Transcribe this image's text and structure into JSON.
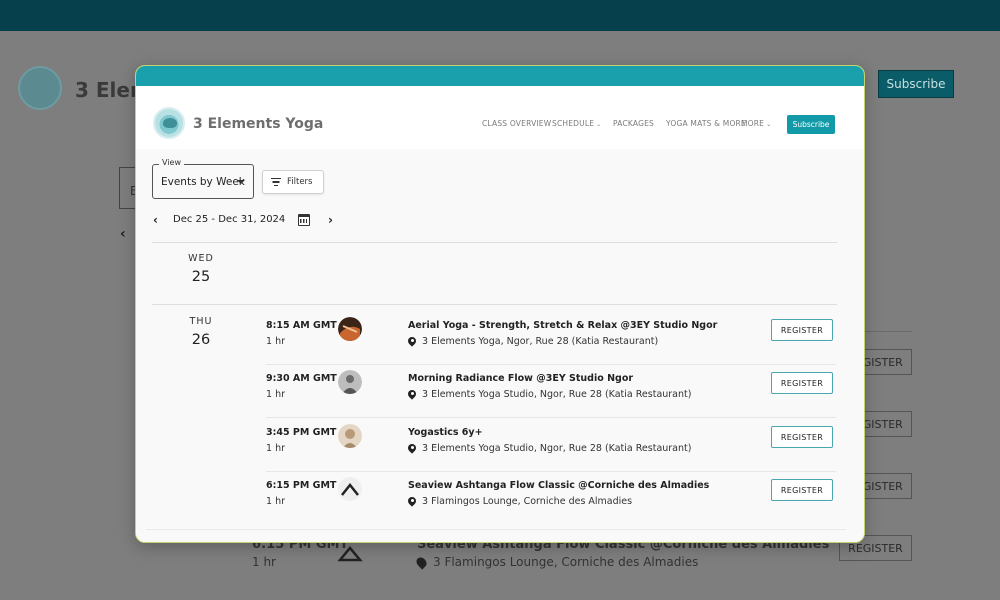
{
  "background": {
    "brand": "3 Elem",
    "subscribe_label": "Subscribe",
    "view_letter": "E",
    "register_label": "REGISTER",
    "last_event": {
      "time": "6:15 PM GMT",
      "duration": "1 hr",
      "title": "Seaview Ashtanga Flow Classic @Corniche des Almadies",
      "location": "3 Flamingos Lounge, Corniche des Almadies"
    }
  },
  "header": {
    "brand": "3 Elements Yoga",
    "nav": [
      {
        "label": "CLASS OVERVIEW",
        "dropdown": false
      },
      {
        "label": "SCHEDULE",
        "dropdown": true
      },
      {
        "label": "PACKAGES",
        "dropdown": false
      },
      {
        "label": "YOGA MATS & MORE",
        "dropdown": false
      },
      {
        "label": "MORE",
        "dropdown": true
      }
    ],
    "subscribe_label": "Subscribe"
  },
  "toolbar": {
    "view_label": "View",
    "view_value": "Events by Week",
    "filters_label": "Filters",
    "date_range": "Dec 25 - Dec 31, 2024"
  },
  "days": [
    {
      "name": "WED",
      "num": "25"
    },
    {
      "name": "THU",
      "num": "26"
    }
  ],
  "events": [
    {
      "time": "8:15 AM GMT",
      "duration": "1 hr",
      "title": "Aerial Yoga - Strength, Stretch & Relax @3EY Studio Ngor",
      "location": "3 Elements Yoga, Ngor, Rue 28 (Katia Restaurant)",
      "register": "REGISTER",
      "avatar_color": "#8a4a2a"
    },
    {
      "time": "9:30 AM GMT",
      "duration": "1 hr",
      "title": "Morning Radiance Flow @3EY Studio Ngor",
      "location": "3 Elements Yoga Studio, Ngor, Rue 28 (Katia Restaurant)",
      "register": "REGISTER",
      "avatar_color": "#9a9a9a"
    },
    {
      "time": "3:45 PM GMT",
      "duration": "1 hr",
      "title": "Yogastics 6y+",
      "location": "3 Elements Yoga Studio, Ngor, Rue 28 (Katia Restaurant)",
      "register": "REGISTER",
      "avatar_color": "#c9b7a0"
    },
    {
      "time": "6:15 PM GMT",
      "duration": "1 hr",
      "title": "Seaview Ashtanga Flow Classic @Corniche des Almadies",
      "location": "3 Flamingos Lounge, Corniche des Almadies",
      "register": "REGISTER",
      "avatar_color": "#d8d8d8"
    }
  ],
  "colors": {
    "accent": "#129aa8",
    "topbar": "#06404d",
    "modal_border": "#c3d46e"
  }
}
